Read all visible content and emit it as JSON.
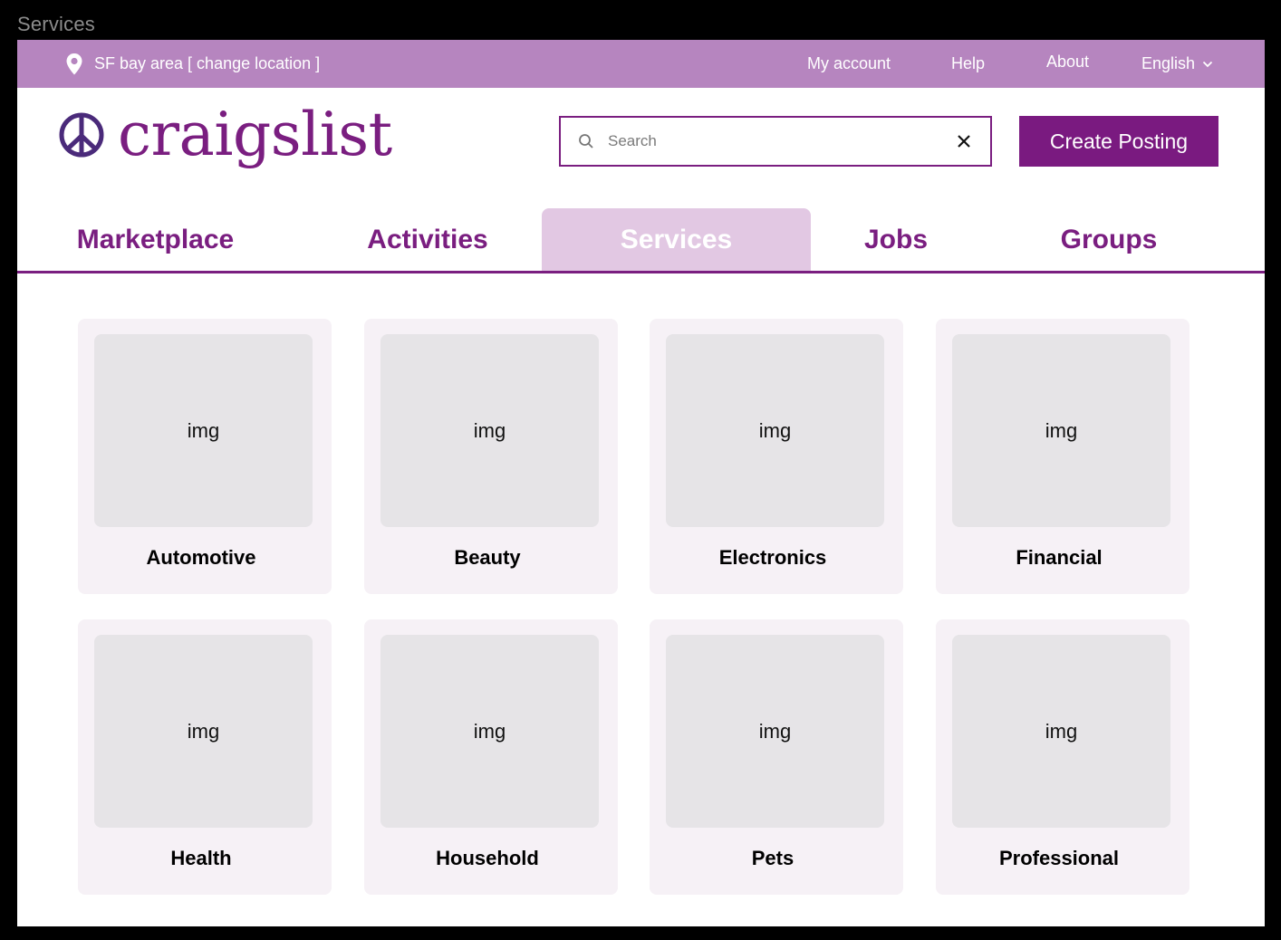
{
  "window": {
    "title": "Services"
  },
  "topbar": {
    "location": "SF bay area [ change location ]",
    "links": {
      "account": "My account",
      "help": "Help",
      "about": "About",
      "language": "English"
    },
    "color": "#b685bf"
  },
  "logo": {
    "text": "craigslist",
    "color": "#7a1e80"
  },
  "search": {
    "placeholder": "Search",
    "value": ""
  },
  "create_button": "Create Posting",
  "tabs": [
    {
      "label": "Marketplace",
      "active": false
    },
    {
      "label": "Activities",
      "active": false
    },
    {
      "label": "Services",
      "active": true
    },
    {
      "label": "Jobs",
      "active": false
    },
    {
      "label": "Groups",
      "active": false
    }
  ],
  "categories": [
    {
      "img": "img",
      "label": "Automotive"
    },
    {
      "img": "img",
      "label": "Beauty"
    },
    {
      "img": "img",
      "label": "Electronics"
    },
    {
      "img": "img",
      "label": "Financial"
    },
    {
      "img": "img",
      "label": "Health"
    },
    {
      "img": "img",
      "label": "Household"
    },
    {
      "img": "img",
      "label": "Pets"
    },
    {
      "img": "img",
      "label": "Professional"
    }
  ],
  "colors": {
    "brand": "#7a1e80",
    "active_tab_bg": "#e2c8e3",
    "card_bg": "#f6f1f6",
    "image_placeholder": "#e6e4e7"
  },
  "icons": [
    "location-pin-icon",
    "chevron-down-icon",
    "peace-sign-icon",
    "search-icon",
    "close-icon"
  ]
}
